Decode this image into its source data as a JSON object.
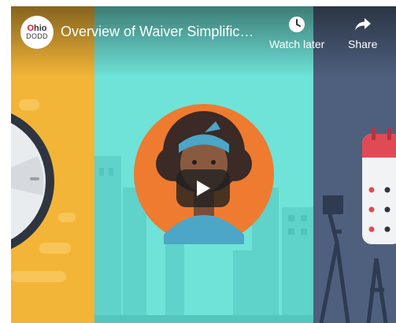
{
  "video": {
    "title": "Overview of Waiver Simplific…",
    "channel_logo": {
      "line1_accent": "O",
      "line1_rest": "hio",
      "line2": "DODD",
      "accent_color": "#c8202f"
    }
  },
  "actions": {
    "watch_later": {
      "label": "Watch later",
      "icon": "clock-icon"
    },
    "share": {
      "label": "Share",
      "icon": "share-arrow-icon"
    }
  },
  "player": {
    "play_icon": "play-icon"
  },
  "colors": {
    "left_panel": "#f3b537",
    "middle_panel": "#6fe3d8",
    "right_panel": "#4e607e",
    "avatar_circle": "#ee7b30"
  }
}
